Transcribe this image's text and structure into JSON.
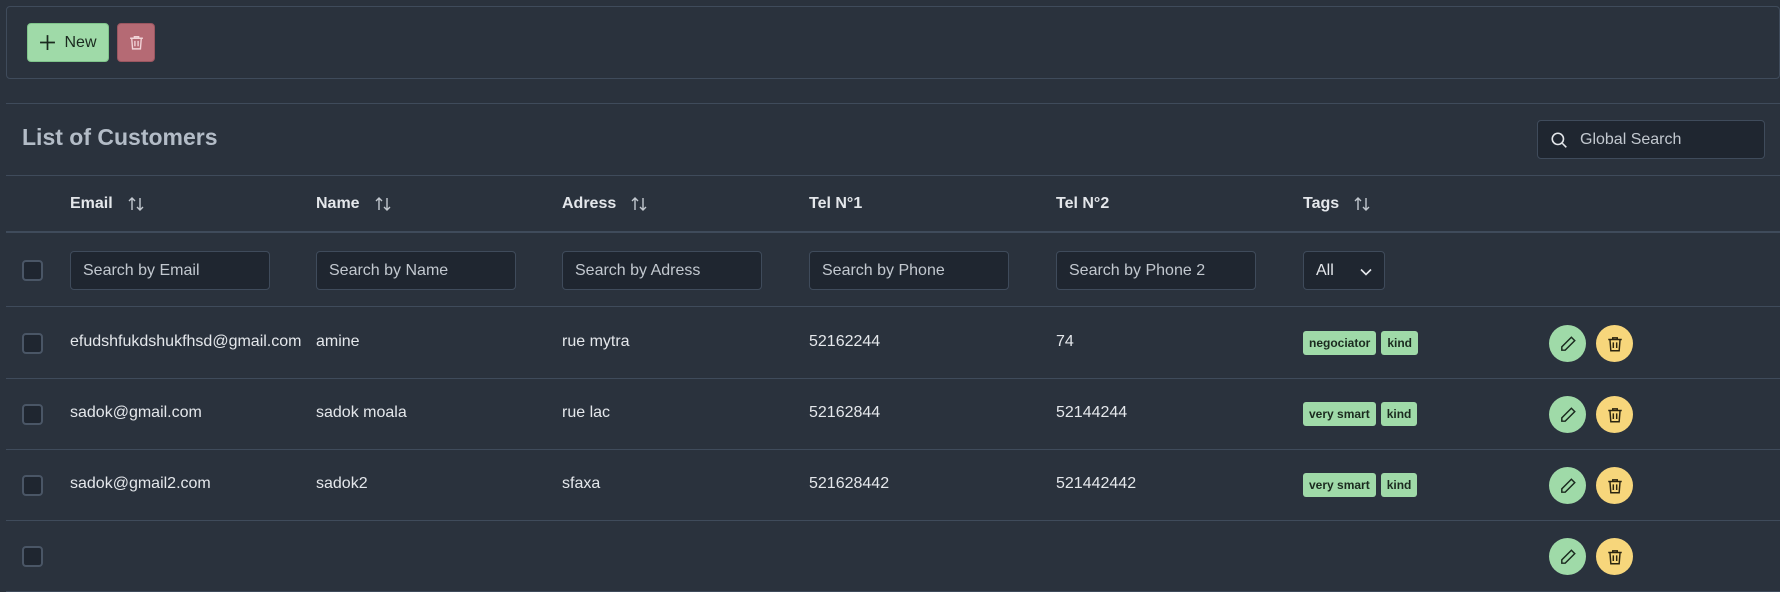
{
  "toolbar": {
    "new_label": "New"
  },
  "list": {
    "title": "List of Customers",
    "global_search_placeholder": "Global Search"
  },
  "columns": {
    "email": "Email",
    "name": "Name",
    "address": "Adress",
    "tel1": "Tel N°1",
    "tel2": "Tel N°2",
    "tags": "Tags"
  },
  "filters": {
    "email": "Search by Email",
    "name": "Search by Name",
    "address": "Search by Adress",
    "tel1": "Search by Phone",
    "tel2": "Search by Phone 2",
    "tags_selected": "All"
  },
  "rows": [
    {
      "email": "efudshfukdshukfhsd@gmail.com",
      "name": "amine",
      "address": "rue mytra",
      "tel1": "52162244",
      "tel2": "74",
      "tags": [
        "negociator",
        "kind"
      ]
    },
    {
      "email": "sadok@gmail.com",
      "name": "sadok moala",
      "address": "rue lac",
      "tel1": "52162844",
      "tel2": "52144244",
      "tags": [
        "very smart",
        "kind"
      ]
    },
    {
      "email": "sadok@gmail2.com",
      "name": "sadok2",
      "address": "sfaxa",
      "tel1": "521628442",
      "tel2": "521442442",
      "tags": [
        "very smart",
        "kind"
      ]
    }
  ],
  "colors": {
    "success": "#9fdaa8",
    "danger": "#b56a74",
    "warning": "#f7d67b",
    "background": "#2a323d"
  }
}
